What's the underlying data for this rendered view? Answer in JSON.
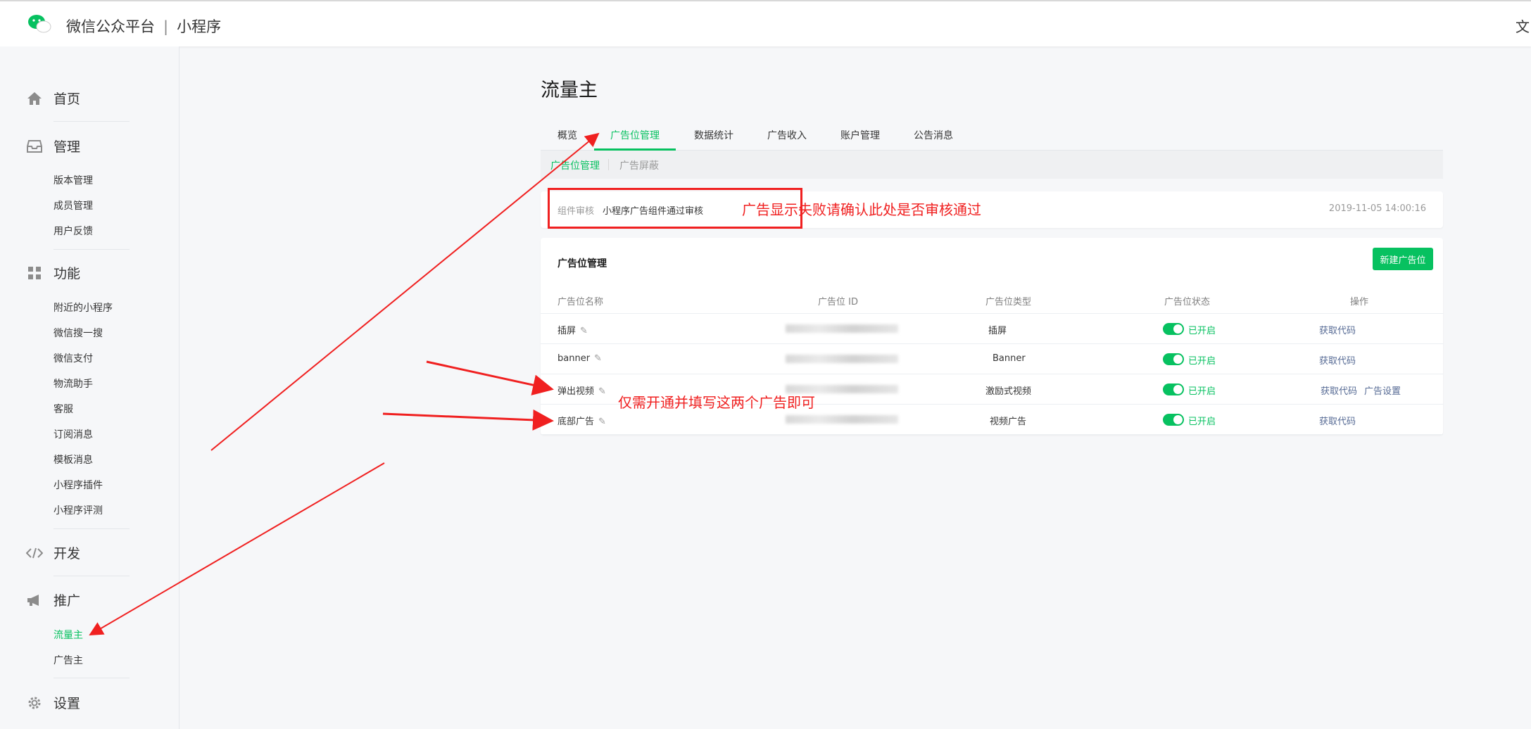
{
  "header": {
    "brand": "微信公众平台",
    "product": "小程序",
    "right_text": "文",
    "brand_color": "#07c160"
  },
  "sidebar": {
    "home": "首页",
    "manage": {
      "label": "管理",
      "items": [
        "版本管理",
        "成员管理",
        "用户反馈"
      ]
    },
    "features": {
      "label": "功能",
      "items": [
        "附近的小程序",
        "微信搜一搜",
        "微信支付",
        "物流助手",
        "客服",
        "订阅消息",
        "模板消息",
        "小程序插件",
        "小程序评测"
      ]
    },
    "develop": "开发",
    "promote": {
      "label": "推广",
      "items": [
        "流量主",
        "广告主"
      ],
      "active": "流量主"
    },
    "settings": "设置"
  },
  "main": {
    "title": "流量主",
    "tabs": [
      "概览",
      "广告位管理",
      "数据统计",
      "广告收入",
      "账户管理",
      "公告消息"
    ],
    "active_tab": "广告位管理",
    "subtabs": [
      "广告位管理",
      "广告屏蔽"
    ],
    "active_subtab": "广告位管理",
    "audit": {
      "label": "组件审核",
      "value": "小程序广告组件通过审核",
      "time": "2019-11-05 14:00:16"
    },
    "table": {
      "title": "广告位管理",
      "new_button": "新建广告位",
      "columns": [
        "广告位名称",
        "广告位 ID",
        "广告位类型",
        "广告位状态",
        "操作"
      ],
      "rows": [
        {
          "name": "插屏",
          "type": "插屏",
          "status": "已开启",
          "actions": [
            "获取代码"
          ]
        },
        {
          "name": "banner",
          "type": "Banner",
          "status": "已开启",
          "actions": [
            "获取代码"
          ]
        },
        {
          "name": "弹出视频",
          "type": "激励式视频",
          "status": "已开启",
          "actions": [
            "获取代码",
            "广告设置"
          ]
        },
        {
          "name": "底部广告",
          "type": "视频广告",
          "status": "已开启",
          "actions": [
            "获取代码"
          ]
        }
      ]
    }
  },
  "annotations": {
    "audit_note": "广告显示失败请确认此处是否审核通过",
    "rows_note": "仅需开通并填写这两个广告即可",
    "color": "#f02020"
  }
}
